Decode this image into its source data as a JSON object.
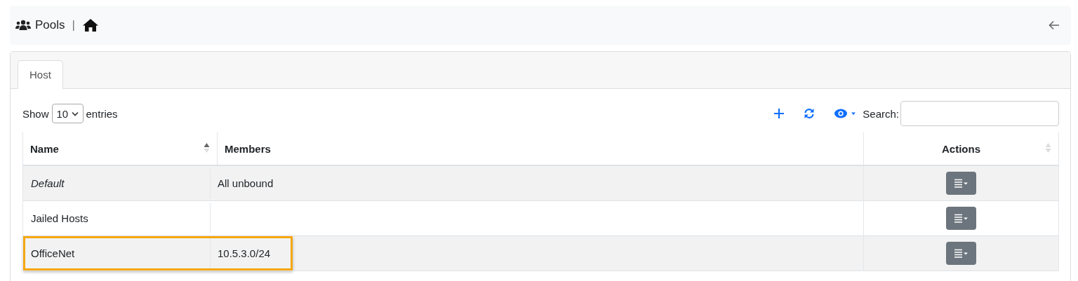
{
  "breadcrumb": {
    "title": "Pools",
    "separator": "|"
  },
  "tabs": [
    {
      "label": "Host",
      "selected": true
    }
  ],
  "length": {
    "before": "Show",
    "value": "10",
    "after": "entries"
  },
  "search": {
    "label": "Search:"
  },
  "table": {
    "columns": [
      {
        "label": "Name",
        "sortable": true,
        "sorted": true,
        "centered": false
      },
      {
        "label": "Members",
        "sortable": false,
        "centered": false
      },
      {
        "label": "Actions",
        "sortable": true,
        "sorted": false,
        "centered": true
      }
    ],
    "rows": [
      {
        "name": "Default",
        "italic": true,
        "members": "All unbound",
        "highlighted": false
      },
      {
        "name": "Jailed Hosts",
        "italic": false,
        "highlighted": false
      },
      {
        "name": "OfficeNet",
        "italic": false,
        "members": "10.5.3.0/24",
        "highlighted": true
      }
    ]
  }
}
